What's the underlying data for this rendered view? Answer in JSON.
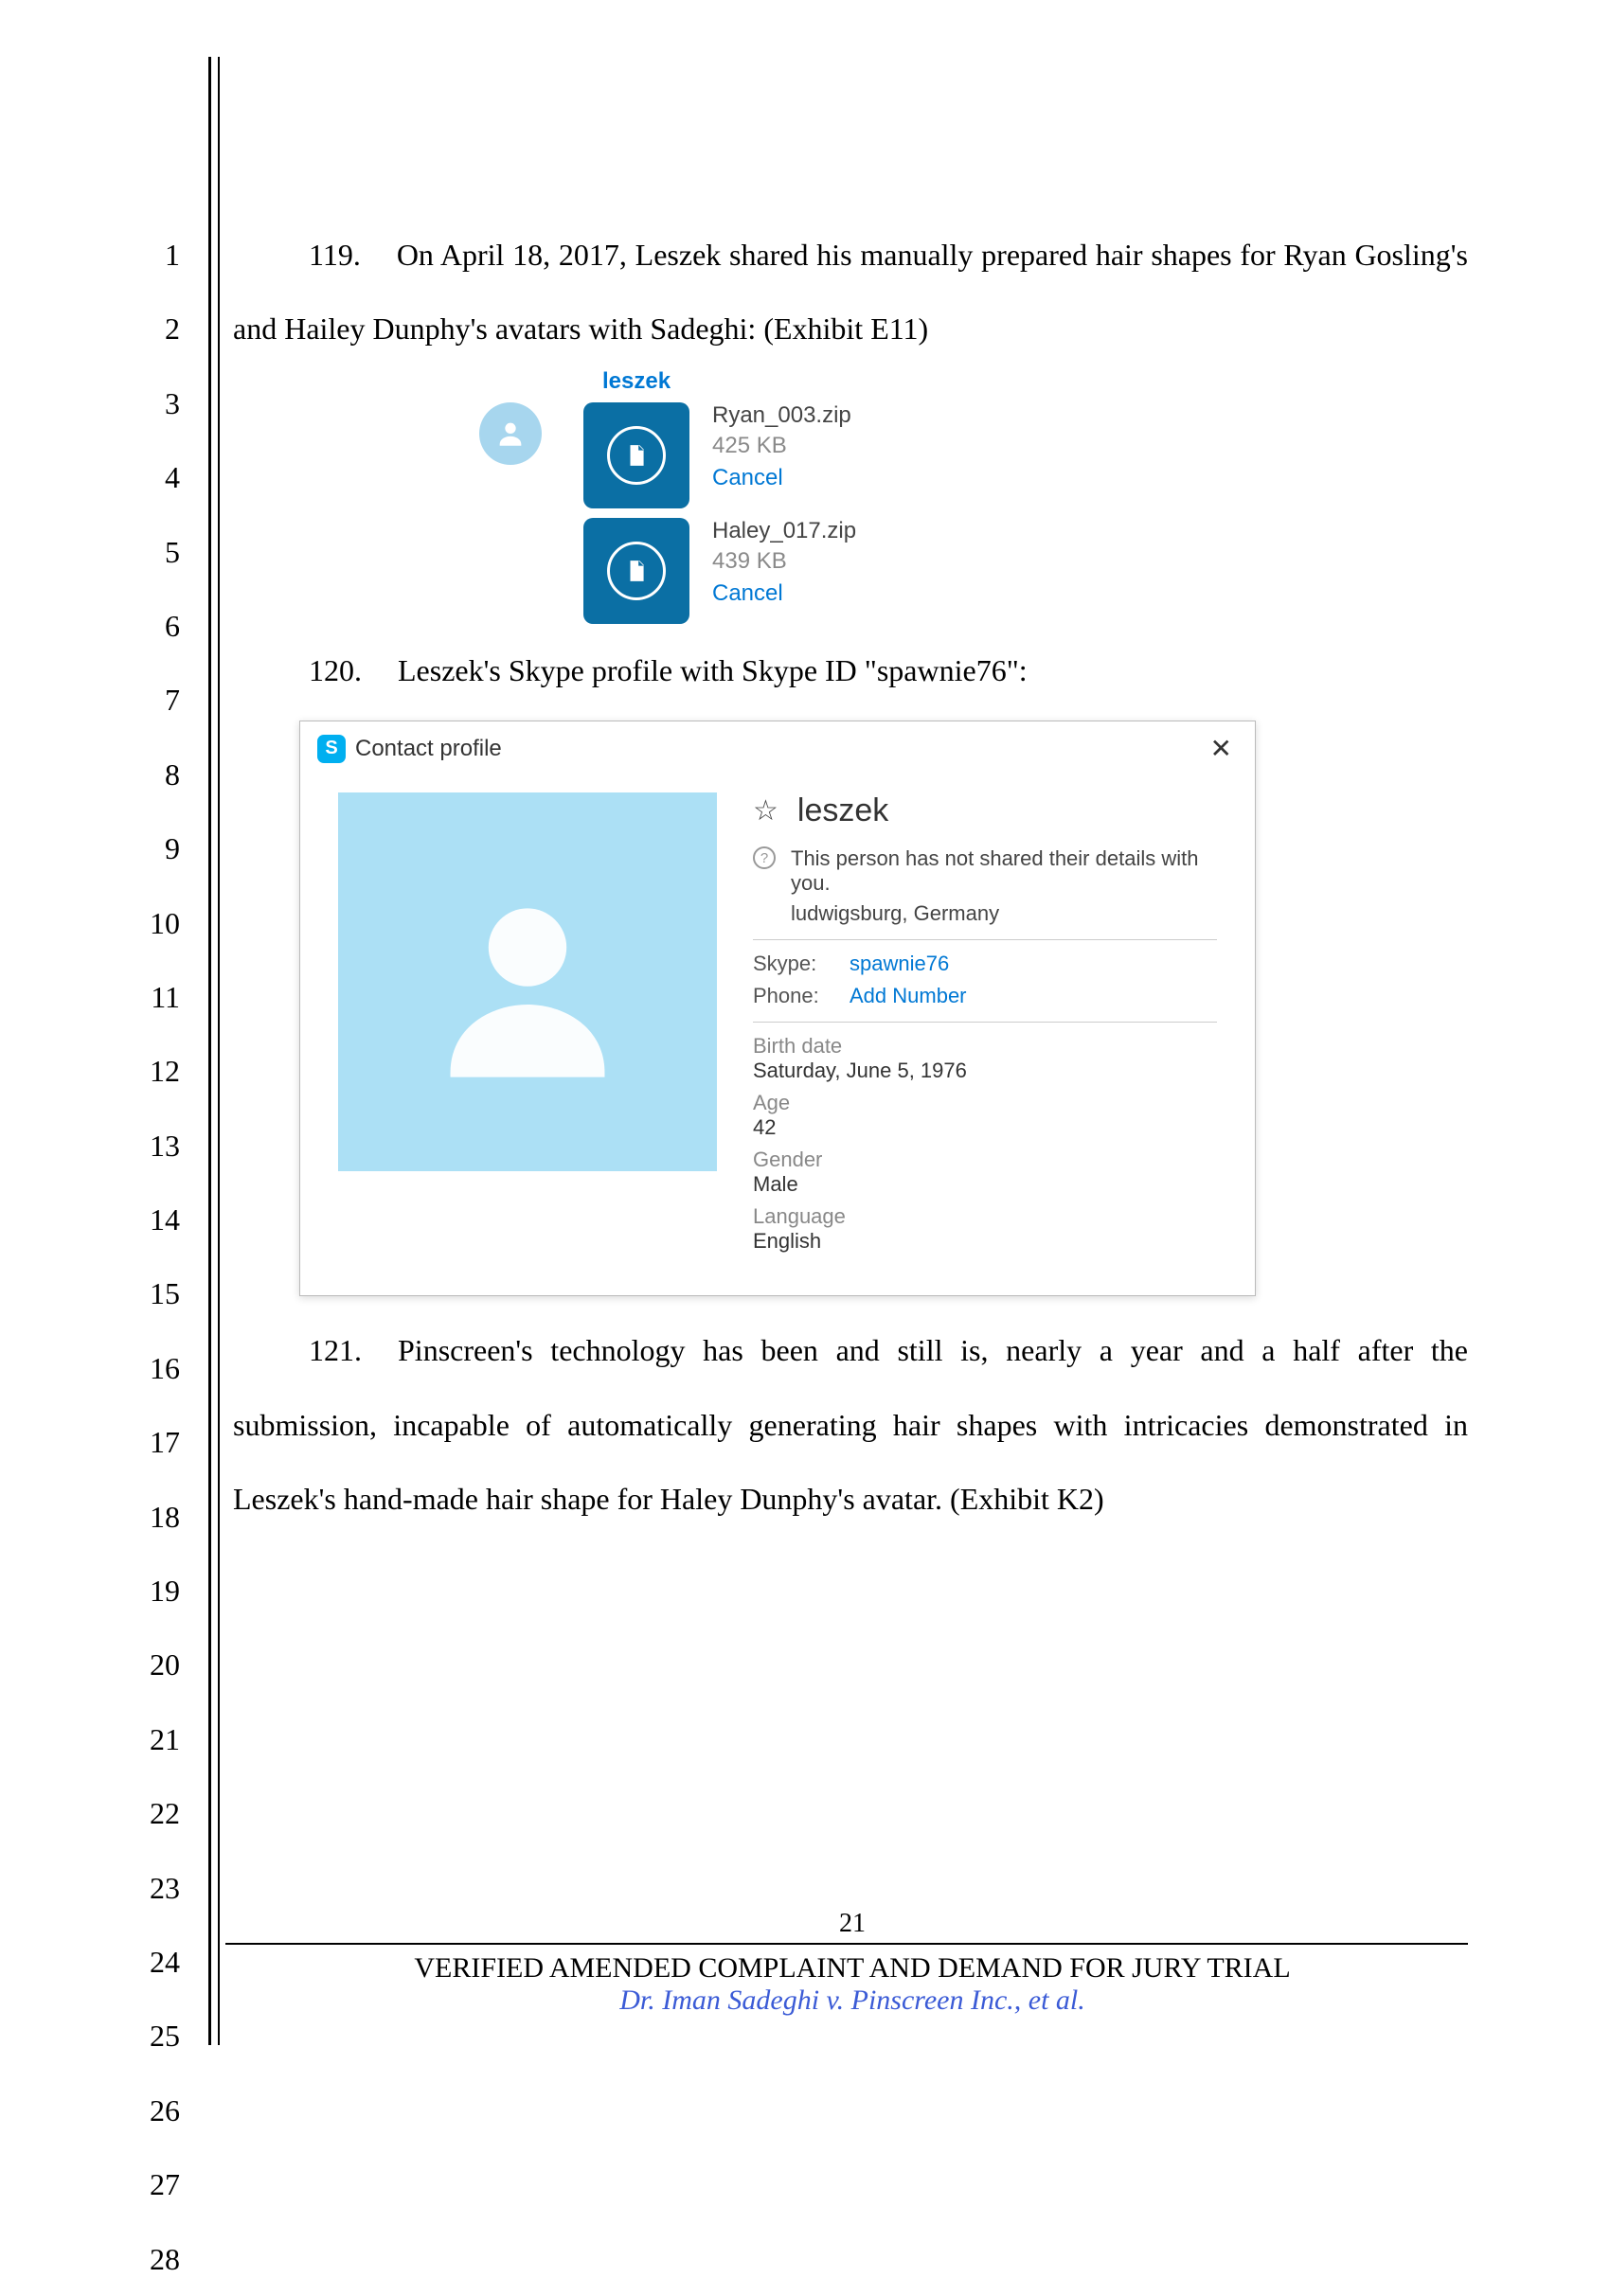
{
  "line_count": 28,
  "paragraphs": {
    "p119": {
      "num": "119.",
      "text": "On April 18, 2017, Leszek shared his manually prepared hair shapes for Ryan Gosling's and Hailey Dunphy's avatars with Sadeghi: (Exhibit E11)"
    },
    "p120": {
      "num": "120.",
      "text": "Leszek's Skype profile with Skype ID \"spawnie76\":"
    },
    "p121": {
      "num": "121.",
      "text": "Pinscreen's technology has been and still is, nearly a year and a half after the submission, incapable of automatically generating hair shapes with intricacies demonstrated in Leszek's hand-made hair shape for Haley Dunphy's avatar. (Exhibit K2)"
    }
  },
  "chat": {
    "sender": "leszek",
    "files": [
      {
        "name": "Ryan_003.zip",
        "size": "425 KB",
        "action": "Cancel"
      },
      {
        "name": "Haley_017.zip",
        "size": "439 KB",
        "action": "Cancel"
      }
    ]
  },
  "skype": {
    "window_title": "Contact profile",
    "logo_letter": "S",
    "name": "leszek",
    "not_shared": "This person has not shared their details with you.",
    "location": "ludwigsburg, Germany",
    "skype_label": "Skype:",
    "skype_id": "spawnie76",
    "phone_label": "Phone:",
    "phone_action": "Add Number",
    "birth_date_label": "Birth date",
    "birth_date": "Saturday, June 5, 1976",
    "age_label": "Age",
    "age": "42",
    "gender_label": "Gender",
    "gender": "Male",
    "language_label": "Language",
    "language": "English"
  },
  "footer": {
    "page_number": "21",
    "title": "VERIFIED AMENDED COMPLAINT AND DEMAND FOR JURY TRIAL",
    "case": "Dr. Iman Sadeghi v. Pinscreen Inc., et al."
  }
}
